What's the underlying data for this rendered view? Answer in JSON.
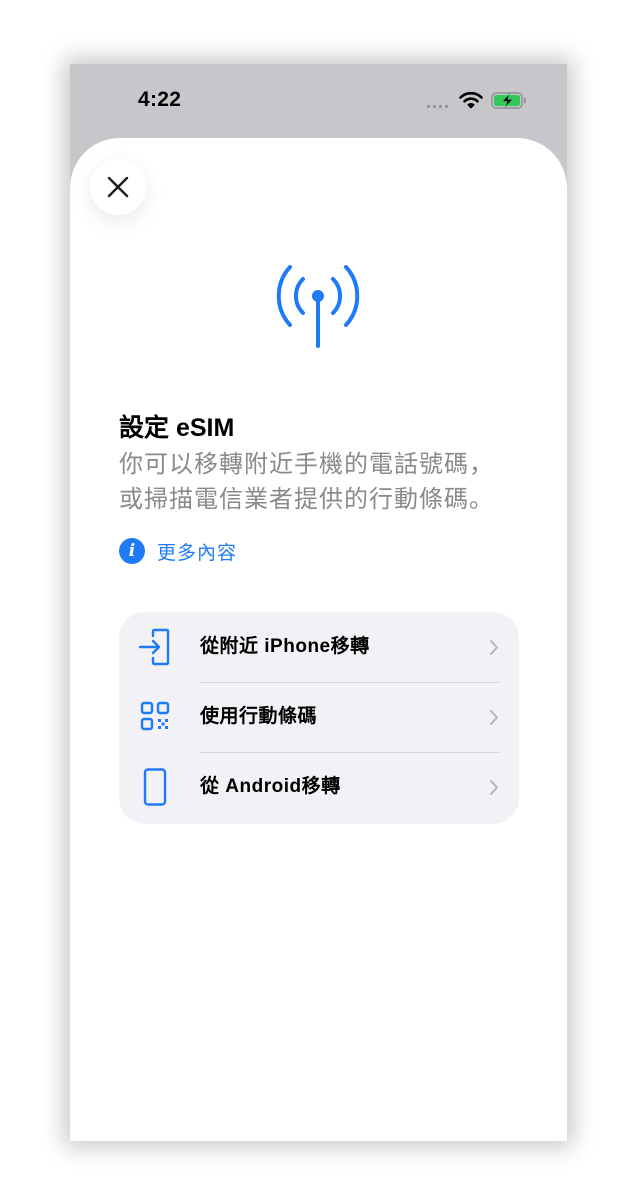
{
  "status_bar": {
    "time": "4:22",
    "icons": [
      "cellular-dots-icon",
      "wifi-icon",
      "battery-charging-icon"
    ],
    "battery_color": "#34c759"
  },
  "sheet": {
    "close_icon": "close-icon",
    "hero_icon": "antenna-icon",
    "title": "設定 eSIM",
    "description_line1": "你可以移轉附近手機的電話號碼，",
    "description_line2": "或掃描電信業者提供的行動條碼。",
    "more_info": {
      "icon": "info-icon",
      "label": "更多內容"
    }
  },
  "options": [
    {
      "icon": "transfer-in-icon",
      "label": "從附近 iPhone移轉"
    },
    {
      "icon": "qr-code-icon",
      "label": "使用行動條碼"
    },
    {
      "icon": "phone-outline-icon",
      "label": "從 Android移轉"
    }
  ],
  "colors": {
    "accent": "#1e7bf5",
    "secondary_text": "#8a8a8e",
    "option_background": "#f2f2f6",
    "backdrop": "#c6c6cb"
  }
}
